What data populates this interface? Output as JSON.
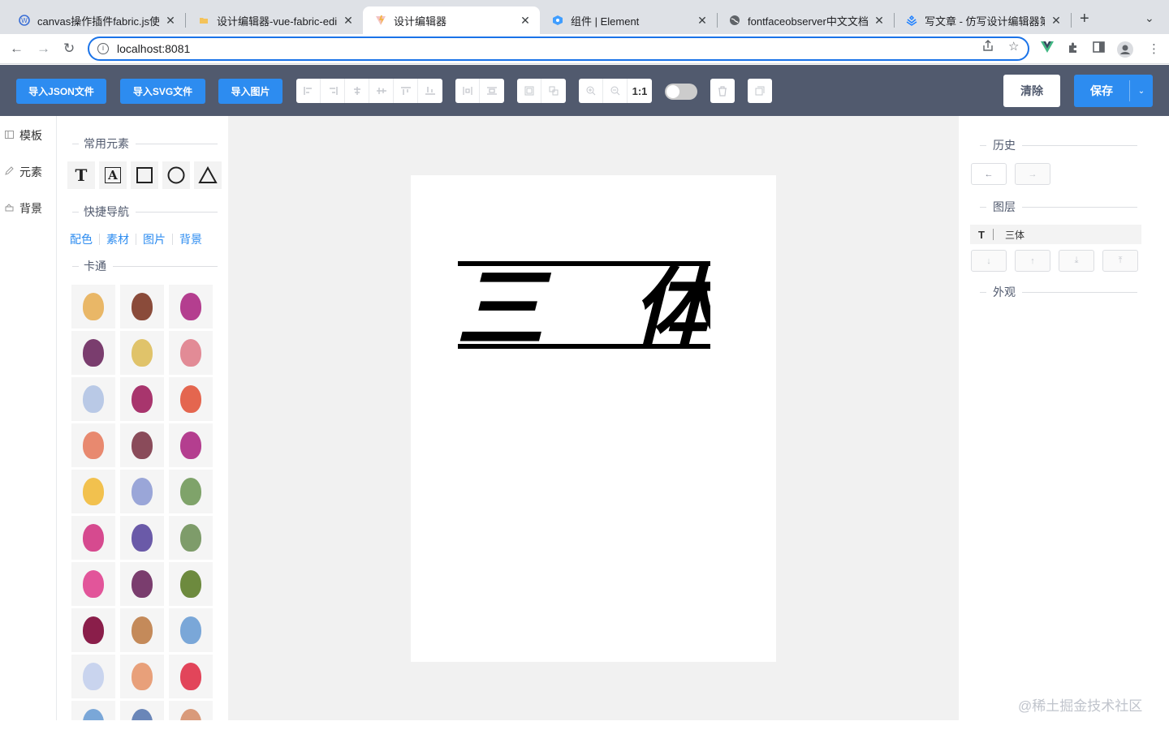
{
  "browser": {
    "tabs": [
      {
        "title": "canvas操作插件fabric.js使用",
        "icon": "wordpress-icon"
      },
      {
        "title": "设计编辑器-vue-fabric-editor",
        "icon": "folder-icon"
      },
      {
        "title": "设计编辑器",
        "icon": "vite-icon"
      },
      {
        "title": "组件 | Element",
        "icon": "element-icon"
      },
      {
        "title": "fontfaceobserver中文文档",
        "icon": "globe-icon"
      },
      {
        "title": "写文章 - 仿写设计编辑器第三",
        "icon": "juejin-icon"
      }
    ],
    "active_tab": 2,
    "url": "localhost:8081"
  },
  "toolbar": {
    "import_json": "导入JSON文件",
    "import_svg": "导入SVG文件",
    "import_image": "导入图片",
    "zoom_reset": "1:1",
    "clear": "清除",
    "save": "保存"
  },
  "left_menu": [
    {
      "label": "模板",
      "icon": "template-icon"
    },
    {
      "label": "元素",
      "icon": "element-icon"
    },
    {
      "label": "背景",
      "icon": "background-icon"
    }
  ],
  "left_panel": {
    "common_elements": "常用元素",
    "quick_nav": "快捷导航",
    "quick_links": [
      "配色",
      "素材",
      "图片",
      "背景"
    ],
    "cartoon": "卡通",
    "cartoon_items": [
      {
        "name": "bow-illustration",
        "color": "#e9b767"
      },
      {
        "name": "centaur-illustration",
        "color": "#8a4b3a"
      },
      {
        "name": "armor-illustration",
        "color": "#b43e8f"
      },
      {
        "name": "dragon-egg-illustration",
        "color": "#7a3d6e"
      },
      {
        "name": "elf-illustration",
        "color": "#e0c36a"
      },
      {
        "name": "map-illustration",
        "color": "#e28b96"
      },
      {
        "name": "fairy-illustration",
        "color": "#b9c9e6"
      },
      {
        "name": "crystal-illustration",
        "color": "#a8356d"
      },
      {
        "name": "meat-illustration",
        "color": "#e4664f"
      },
      {
        "name": "pouch-illustration",
        "color": "#e8896f"
      },
      {
        "name": "reaper-illustration",
        "color": "#8a4b5a"
      },
      {
        "name": "helmet-illustration",
        "color": "#b43e8f"
      },
      {
        "name": "king-illustration",
        "color": "#f2c14e"
      },
      {
        "name": "knight-illustration",
        "color": "#9aa6d8"
      },
      {
        "name": "medusa-illustration",
        "color": "#7fa36a"
      },
      {
        "name": "unicorn-pink-illustration",
        "color": "#d64a8f"
      },
      {
        "name": "spider-illustration",
        "color": "#6a5aa8"
      },
      {
        "name": "goblin-illustration",
        "color": "#7e9c6a"
      },
      {
        "name": "potion-illustration",
        "color": "#e2559a"
      },
      {
        "name": "witch-illustration",
        "color": "#7a3d6e"
      },
      {
        "name": "tree-illustration",
        "color": "#6d8a3e"
      },
      {
        "name": "spellbook-illustration",
        "color": "#8a1e4a"
      },
      {
        "name": "viking-illustration",
        "color": "#c48a5a"
      },
      {
        "name": "sword-illustration",
        "color": "#7aa7d8"
      },
      {
        "name": "unicorn-illustration",
        "color": "#c9d4ee"
      },
      {
        "name": "hero-illustration",
        "color": "#e8a07a"
      },
      {
        "name": "fire-illustration",
        "color": "#e2455a"
      },
      {
        "name": "castle-illustration",
        "color": "#7aa7d8"
      },
      {
        "name": "mountain-illustration",
        "color": "#6a86b8"
      },
      {
        "name": "dwarf-illustration",
        "color": "#d99a7a"
      }
    ]
  },
  "canvas": {
    "title_text": "三体"
  },
  "right_panel": {
    "history": "历史",
    "layers": "图层",
    "appearance": "外观",
    "layer_items": [
      {
        "type_icon": "T",
        "name": "三体"
      }
    ]
  },
  "watermark": "@稀土掘金技术社区"
}
